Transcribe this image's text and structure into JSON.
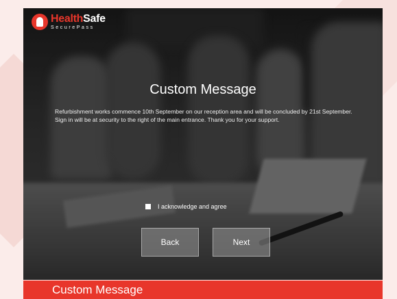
{
  "brand": {
    "name_part1": "Health",
    "name_part2": "Safe",
    "tagline": "SecurePass"
  },
  "page": {
    "title": "Custom Message",
    "message": "Refurbishment works commence 10th September on our reception area and will be concluded by 21st September. Sign in will be at security to the right of the main entrance. Thank you for your support."
  },
  "acknowledge": {
    "label": "I acknowledge and agree",
    "checked": false
  },
  "buttons": {
    "back_label": "Back",
    "next_label": "Next"
  },
  "footer": {
    "caption": "Custom Message"
  },
  "colors": {
    "accent": "#e8362b"
  }
}
